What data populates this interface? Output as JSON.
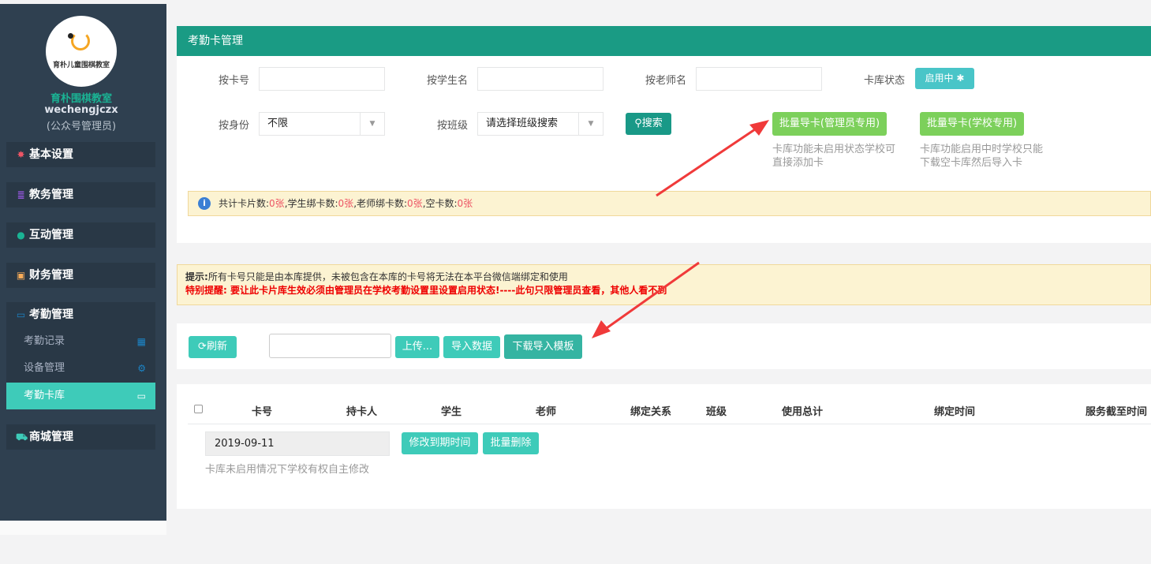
{
  "sidebar": {
    "logo_text": "育朴儿童围棋教室",
    "school_name": "育朴围棋教室",
    "user_id": "wechengjczx",
    "user_role": "(公众号管理员)",
    "menu": [
      {
        "label": "基本设置",
        "icon": "gear-icon"
      },
      {
        "label": "教务管理",
        "icon": "database-icon"
      },
      {
        "label": "互动管理",
        "icon": "wechat-icon"
      },
      {
        "label": "财务管理",
        "icon": "money-icon"
      },
      {
        "label": "考勤管理",
        "icon": "card-icon"
      },
      {
        "label": "商城管理",
        "icon": "cart-icon"
      }
    ],
    "submenu": [
      {
        "label": "考勤记录",
        "icon": "grid-icon"
      },
      {
        "label": "设备管理",
        "icon": "cogs-icon"
      },
      {
        "label": "考勤卡库",
        "icon": "card-icon"
      }
    ]
  },
  "panel": {
    "title": "考勤卡管理",
    "labels": {
      "card_no": "按卡号",
      "student": "按学生名",
      "teacher": "按老师名",
      "status": "卡库状态",
      "identity": "按身份",
      "class": "按班级"
    },
    "status_button": "启用中",
    "identity_value": "不限",
    "class_value": "请选择班级搜索",
    "search_button": "搜索",
    "batch_admin_button": "批量导卡(管理员专用)",
    "batch_school_button": "批量导卡(学校专用)",
    "hint_admin_1": "卡库功能未启用状态学校可",
    "hint_admin_2": "直接添加卡",
    "hint_school_1": "卡库功能启用中时学校只能",
    "hint_school_2": "下载空卡库然后导入卡",
    "stats": {
      "total_label": "共计卡片数:",
      "total": "0张",
      "student_label": ",学生绑卡数:",
      "student": "0张",
      "teacher_label": ",老师绑卡数:",
      "teacher": "0张",
      "empty_label": ",空卡数:",
      "empty": "0张"
    }
  },
  "notice": {
    "prefix": "提示:",
    "line1": "所有卡号只能是由本库提供，未被包含在本库的卡号将无法在本平台微信端绑定和使用",
    "line2": "特别提醒: 要让此卡片库生效必须由管理员在学校考勤设置里设置启用状态!----此句只限管理员查看，其他人看不到"
  },
  "toolbar": {
    "refresh": "刷新",
    "upload": "上传...",
    "import": "导入数据",
    "download": "下载导入模板"
  },
  "table": {
    "headers": [
      "卡号",
      "持卡人",
      "学生",
      "老师",
      "绑定关系",
      "班级",
      "使用总计",
      "绑定时间",
      "服务截至时间"
    ],
    "date_value": "2019-09-11",
    "modify_button": "修改到期时间",
    "batch_delete_button": "批量删除",
    "footnote": "卡库未启用情况下学校有权自主修改"
  }
}
